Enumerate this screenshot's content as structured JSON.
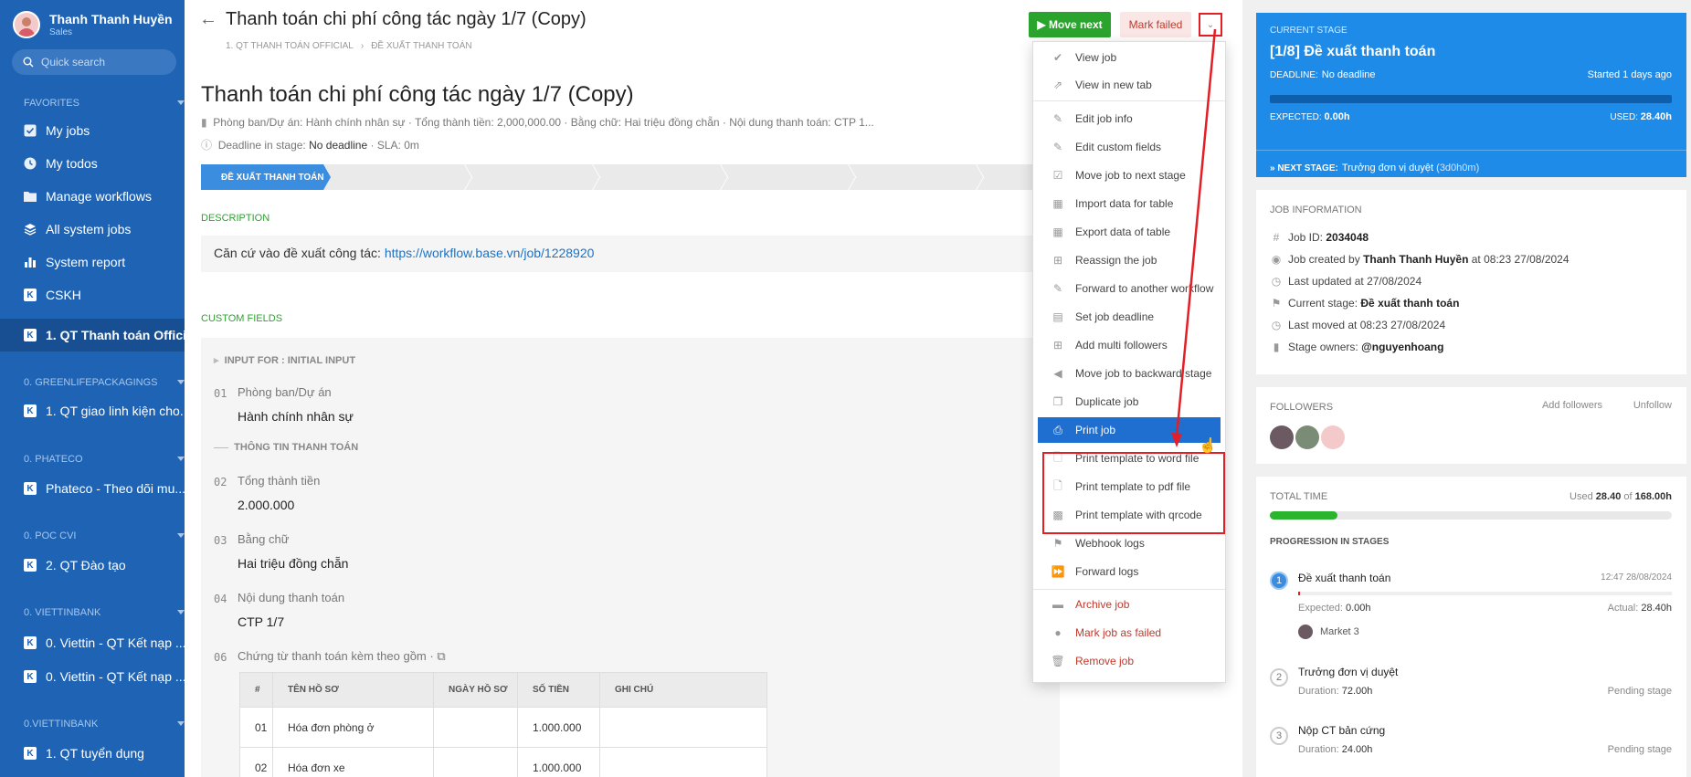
{
  "user": {
    "name": "Thanh Thanh Huyền",
    "role": "Sales"
  },
  "search": {
    "placeholder": "Quick search"
  },
  "sidebar": {
    "favorites_label": "FAVORITES",
    "favorites": [
      "My jobs",
      "My todos",
      "Manage workflows",
      "All system jobs",
      "System report",
      "CSKH",
      "1. QT Thanh toán Official"
    ],
    "groups": [
      {
        "label": "0. GREENLIFEPACKAGINGS",
        "items": [
          "1. QT giao linh kiện cho..."
        ]
      },
      {
        "label": "0. PHATECO",
        "items": [
          "Phateco - Theo dõi mu..."
        ]
      },
      {
        "label": "0. POC CVI",
        "items": [
          "2. QT Đào tạo"
        ]
      },
      {
        "label": "0. VIETTINBANK",
        "items": [
          "0. Viettin - QT Kết nạp ...",
          "0. Viettin - QT Kết nạp ..."
        ]
      },
      {
        "label": "0.VIETTINBANK",
        "items": [
          "1. QT tuyển dụng"
        ]
      }
    ]
  },
  "header": {
    "title": "Thanh toán chi phí công tác ngày 1/7 (Copy)",
    "crumb1": "1. QT THANH TOÁN OFFICIAL",
    "crumb2": "ĐỀ XUẤT THANH TOÁN",
    "move_next": "Move next",
    "mark_failed": "Mark failed"
  },
  "job": {
    "title": "Thanh toán chi phí công tác ngày 1/7 (Copy)",
    "meta": "Phòng ban/Dự án: Hành chính nhân sự · Tổng thành tiền: 2,000,000.00 · Bằng chữ: Hai triệu đồng chẵn · Nội dung thanh toán: CTP 1...",
    "deadline_label": "Deadline in stage:",
    "deadline_value": "No deadline",
    "sla": "· SLA: 0m",
    "active_stage": "ĐỀ XUẤT THANH TOÁN"
  },
  "description": {
    "label": "DESCRIPTION",
    "text": "Căn cứ vào đề xuất công tác: ",
    "link": "https://workflow.base.vn/job/1228920"
  },
  "custom_fields": {
    "label": "CUSTOM FIELDS",
    "input_for": "INPUT FOR : INITIAL INPUT",
    "group": "THÔNG TIN THANH TOÁN",
    "fields": [
      {
        "num": "01",
        "label": "Phòng ban/Dự án",
        "value": "Hành chính nhân sự"
      },
      {
        "num": "02",
        "label": "Tổng thành tiền",
        "value": "2.000.000"
      },
      {
        "num": "03",
        "label": "Bằng chữ",
        "value": "Hai triệu đồng chẵn"
      },
      {
        "num": "04",
        "label": "Nội dung thanh toán",
        "value": "CTP 1/7"
      },
      {
        "num": "06",
        "label": "Chứng từ thanh toán kèm theo gồm ·",
        "value": ""
      }
    ],
    "table": {
      "headers": [
        "#",
        "TÊN HỒ SƠ",
        "NGÀY HỒ SƠ",
        "SỐ TIỀN",
        "GHI CHÚ"
      ],
      "rows": [
        [
          "01",
          "Hóa đơn phòng ở",
          "",
          "1.000.000",
          ""
        ],
        [
          "02",
          "Hóa đơn xe",
          "",
          "1.000.000",
          ""
        ]
      ]
    }
  },
  "menu": {
    "items": [
      {
        "label": "View job",
        "icon": "check-icon"
      },
      {
        "label": "View in new tab",
        "icon": "external-link-icon"
      },
      {
        "label": "Edit job info",
        "icon": "edit-icon"
      },
      {
        "label": "Edit custom fields",
        "icon": "edit-icon"
      },
      {
        "label": "Move job to next stage",
        "icon": "check-square-icon"
      },
      {
        "label": "Import data for table",
        "icon": "table-icon"
      },
      {
        "label": "Export data of table",
        "icon": "table-icon"
      },
      {
        "label": "Reassign the job",
        "icon": "plus-square-icon"
      },
      {
        "label": "Forward to another workflow",
        "icon": "edit-icon"
      },
      {
        "label": "Set job deadline",
        "icon": "calendar-icon"
      },
      {
        "label": "Add multi followers",
        "icon": "plus-square-icon"
      },
      {
        "label": "Move job to backward stage",
        "icon": "back-circle-icon"
      },
      {
        "label": "Duplicate job",
        "icon": "duplicate-icon"
      },
      {
        "label": "Print job",
        "icon": "printer-icon"
      },
      {
        "label": "Print template to word file",
        "icon": "word-file-icon"
      },
      {
        "label": "Print template to pdf file",
        "icon": "pdf-file-icon"
      },
      {
        "label": "Print template with qrcode",
        "icon": "qrcode-icon"
      },
      {
        "label": "Webhook logs",
        "icon": "flag-icon"
      },
      {
        "label": "Forward logs",
        "icon": "forward-icon"
      },
      {
        "label": "Archive job",
        "icon": "archive-icon"
      },
      {
        "label": "Mark job as failed",
        "icon": "alert-icon"
      },
      {
        "label": "Remove job",
        "icon": "trash-icon"
      }
    ]
  },
  "current_stage": {
    "label": "CURRENT STAGE",
    "title": "[1/8] Đề xuất thanh toán",
    "deadline_label": "DEADLINE:",
    "deadline_value": "No deadline",
    "started": "Started 1 days ago",
    "expected_label": "EXPECTED:",
    "expected_value": "0.00h",
    "used_label": "USED:",
    "used_value": "28.40h",
    "next_label": "» NEXT STAGE:",
    "next_value": "Trưởng đơn vị duyệt",
    "next_duration": "(3d0h0m)"
  },
  "job_info": {
    "label": "JOB INFORMATION",
    "job_id_label": "Job ID:",
    "job_id": "2034048",
    "created_prefix": "Job created by",
    "created_by": "Thanh Thanh Huyền",
    "created_suffix": "at 08:23 27/08/2024",
    "last_updated": "Last updated at 27/08/2024",
    "current_stage_label": "Current stage:",
    "current_stage": "Đề xuất thanh toán",
    "last_moved": "Last moved at 08:23 27/08/2024",
    "owners_label": "Stage owners:",
    "owners": "@nguyenhoang"
  },
  "followers": {
    "label": "FOLLOWERS",
    "add": "Add followers",
    "unfollow": "Unfollow"
  },
  "total_time": {
    "label": "TOTAL TIME",
    "used_prefix": "Used",
    "used": "28.40",
    "of": "of",
    "total": "168.00h",
    "progress": 0.169,
    "progression_label": "PROGRESSION IN STAGES"
  },
  "stages": [
    {
      "num": "1",
      "name": "Đề xuất thanh toán",
      "time": "12:47 28/08/2024",
      "expected_label": "Expected:",
      "expected": "0.00h",
      "actual_label": "Actual:",
      "actual": "28.40h",
      "assignee": "Market 3"
    },
    {
      "num": "2",
      "name": "Trưởng đơn vị duyệt",
      "duration_label": "Duration:",
      "duration": "72.00h",
      "status": "Pending stage"
    },
    {
      "num": "3",
      "name": "Nộp CT bản cứng",
      "duration_label": "Duration:",
      "duration": "24.00h",
      "status": "Pending stage"
    }
  ],
  "colors": {
    "sidebar": "#1e63b4",
    "accent": "#1e8be8",
    "success": "#2ba42e",
    "danger": "#e31e24"
  }
}
